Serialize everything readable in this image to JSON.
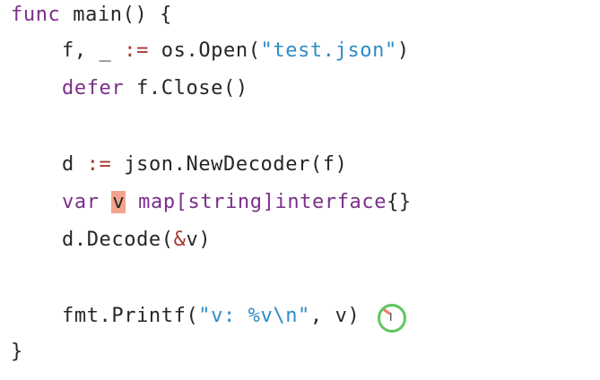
{
  "code_lines": {
    "l1": {
      "kw": "func",
      "rest": " main() {"
    },
    "l2": {
      "a": "f, _ ",
      "op": ":=",
      "b": " os.Open(",
      "str": "\"test.json\"",
      "c": ")"
    },
    "l3": {
      "kw": "defer",
      "rest": " f.Close()"
    },
    "l4": {
      "a": "d ",
      "op": ":=",
      "b": " json.NewDecoder(f)"
    },
    "l5": {
      "kw": "var",
      "sel": "v",
      "kw2": "map",
      "b": "[",
      "kw3": "string",
      "c": "]",
      "kw4": "interface",
      "d": "{}"
    },
    "l6": {
      "a": "d.Decode(",
      "op": "&",
      "b": "v)"
    },
    "l7": {
      "a": "fmt.Printf(",
      "str": "\"v: %v\\n\"",
      "b": ", v)"
    },
    "l8": {
      "a": "}"
    }
  },
  "colors": {
    "keyword": "#7b2f8a",
    "string": "#2f8bc6",
    "operator": "#a43a2f",
    "selection": "#f4a38d",
    "click_ring": "#5ec75e"
  },
  "cursor": {
    "glyph": "I"
  }
}
